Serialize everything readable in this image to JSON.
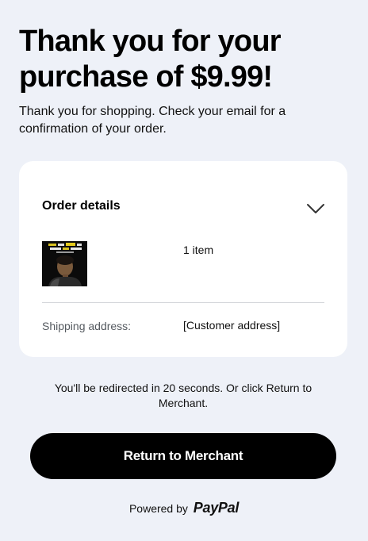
{
  "header": {
    "title": "Thank you for your purchase of $9.99!",
    "subtitle": "Thank you for shopping. Check your email for a confirmation of your order."
  },
  "order": {
    "section_title": "Order details",
    "toggle_icon": "chevron-down-icon",
    "item_count": "1 item",
    "shipping_label": "Shipping address:",
    "shipping_value": "[Customer address]"
  },
  "redirect_text": "You'll be redirected in 20 seconds. Or click Return to Merchant.",
  "return_button": "Return to Merchant",
  "footer": {
    "powered_by": "Powered by",
    "brand": "PayPal"
  },
  "colors": {
    "page_background": "#eef1f8",
    "card_background": "#ffffff",
    "button_background": "#000000",
    "button_text": "#ffffff"
  }
}
